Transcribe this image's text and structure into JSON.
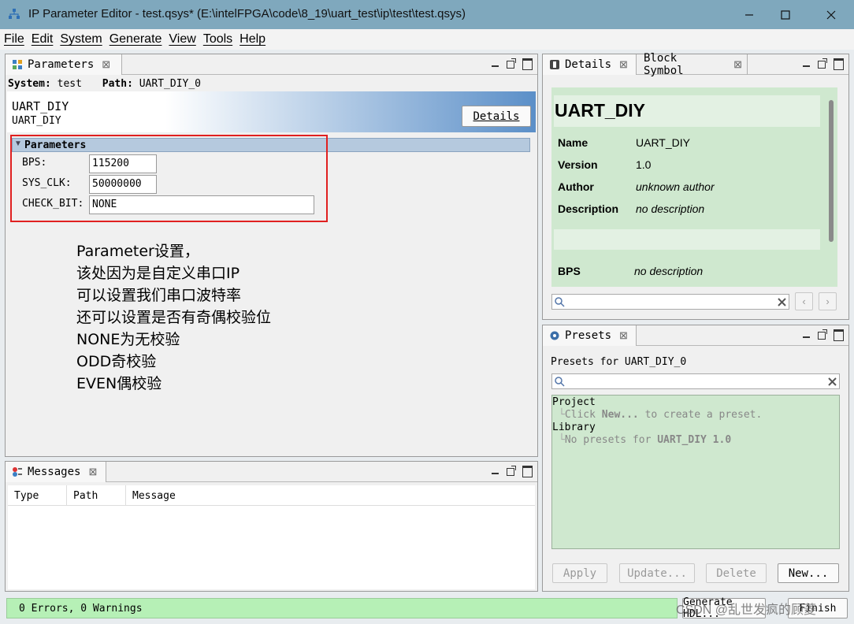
{
  "window": {
    "title": "IP Parameter Editor - test.qsys* (E:\\intelFPGA\\code\\8_19\\uart_test\\ip\\test\\test.qsys)",
    "minimize": "—",
    "maximize": "☐",
    "close": "✕"
  },
  "menu": [
    "File",
    "Edit",
    "System",
    "Generate",
    "View",
    "Tools",
    "Help"
  ],
  "parameters_panel": {
    "tab_label": "Parameters",
    "system_label": "System:",
    "system_value": "test",
    "path_label": "Path:",
    "path_value": "UART_DIY_0",
    "component_name": "UART_DIY",
    "component_sub": "UART_DIY",
    "details_button": "Details",
    "group_title": "Parameters",
    "params": [
      {
        "label": "BPS:",
        "value": "115200"
      },
      {
        "label": "SYS_CLK:",
        "value": "50000000"
      },
      {
        "label": "CHECK_BIT:",
        "value": "NONE"
      }
    ],
    "annotation_lines": [
      "Parameter设置，",
      "该处因为是自定义串口IP",
      "可以设置我们串口波特率",
      "还可以设置是否有奇偶校验位",
      "NONE为无校验",
      "ODD奇校验",
      "EVEN偶校验"
    ],
    "highlight_color": "#e02020"
  },
  "messages_panel": {
    "tab_label": "Messages",
    "columns": [
      "Type",
      "Path",
      "Message"
    ]
  },
  "details_panel": {
    "tab_label": "Details",
    "tab2_label": "Block Symbol",
    "heading": "UART_DIY",
    "rows": [
      {
        "key": "Name",
        "value": "UART_DIY"
      },
      {
        "key": "Version",
        "value": "1.0"
      },
      {
        "key": "Author",
        "value": "unknown author"
      },
      {
        "key": "Description",
        "value": "no description"
      }
    ],
    "param_row": {
      "key": "BPS",
      "value": "no description"
    }
  },
  "presets_panel": {
    "tab_label": "Presets",
    "subtitle": "Presets for UART_DIY_0",
    "tree": {
      "project": "Project",
      "project_hint_pre": "Click ",
      "project_hint_bold": "New...",
      "project_hint_post": " to create a preset.",
      "library": "Library",
      "library_hint_pre": "No presets for ",
      "library_hint_bold": "UART_DIY 1.0"
    },
    "buttons": {
      "apply": "Apply",
      "update": "Update...",
      "delete": "Delete",
      "new": "New..."
    }
  },
  "status_bar": {
    "text": "0 Errors, 0 Warnings",
    "generate_hdl": "Generate HDL...",
    "finish": "Finish",
    "watermark": "CSDN @乱世发疯的顾菱",
    "status_color": "#b6f0b6"
  }
}
